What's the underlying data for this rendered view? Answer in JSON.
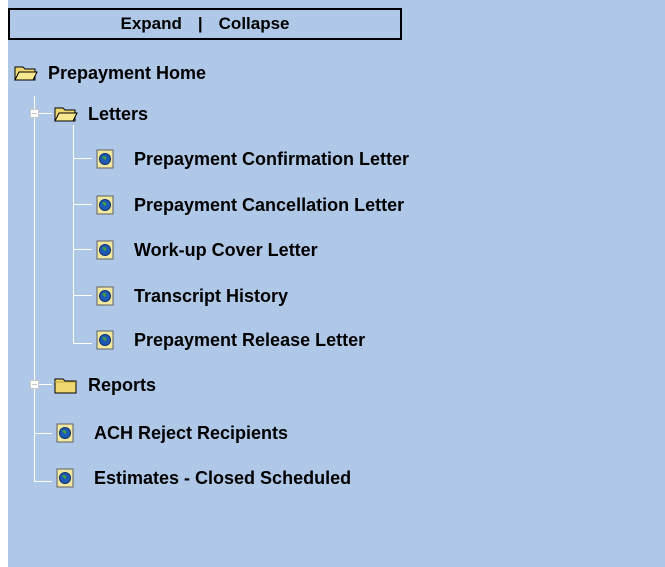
{
  "toolbar": {
    "expand_label": "Expand",
    "separator": "|",
    "collapse_label": "Collapse"
  },
  "tree": {
    "root": {
      "label": "Prepayment Home",
      "icon": "folder-open-icon"
    },
    "letters": {
      "label": "Letters",
      "icon": "folder-open-icon",
      "expanded": true,
      "items": [
        {
          "label": "Prepayment Confirmation Letter",
          "icon": "document-globe-icon"
        },
        {
          "label": "Prepayment Cancellation Letter",
          "icon": "document-globe-icon"
        },
        {
          "label": "Work-up Cover Letter",
          "icon": "document-globe-icon"
        },
        {
          "label": "Transcript History",
          "icon": "document-globe-icon"
        },
        {
          "label": "Prepayment Release Letter",
          "icon": "document-globe-icon"
        }
      ]
    },
    "reports": {
      "label": "Reports",
      "icon": "folder-closed-icon",
      "expanded": false
    },
    "top_items": [
      {
        "label": "ACH Reject Recipients",
        "icon": "document-globe-icon"
      },
      {
        "label": "Estimates - Closed Scheduled",
        "icon": "document-globe-icon"
      }
    ]
  },
  "colors": {
    "panel_background": "#b0c8e8",
    "tree_line": "#ffffff",
    "folder": "#f0d870",
    "globe": "#1e5ab4"
  }
}
